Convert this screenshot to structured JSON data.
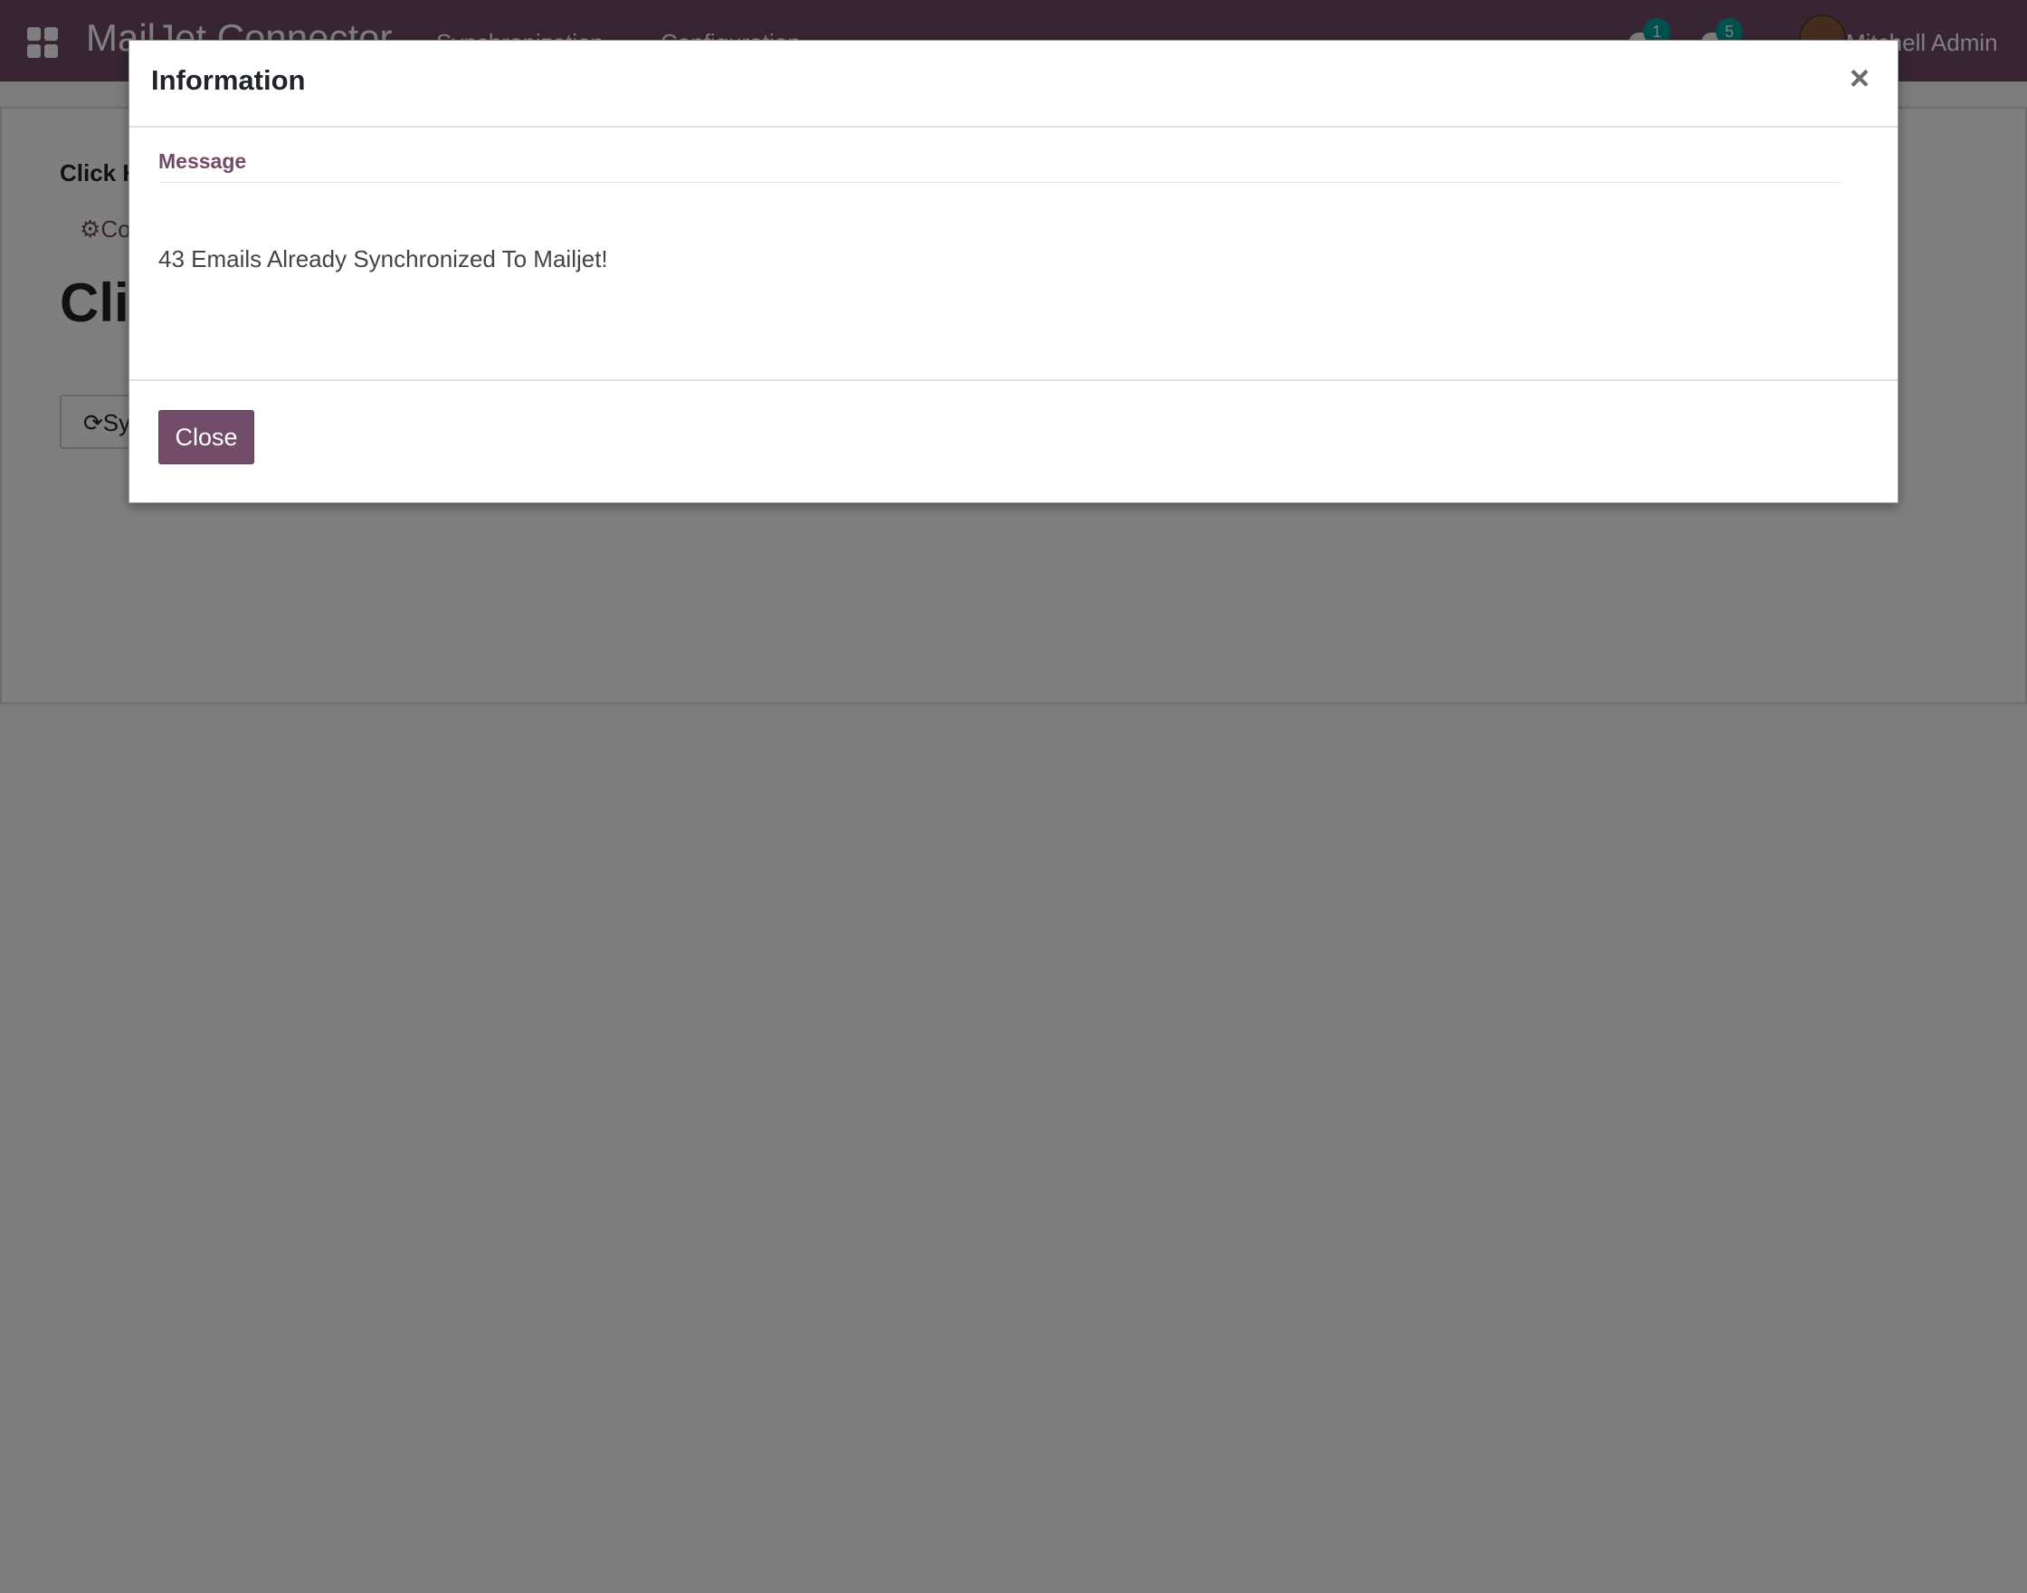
{
  "navbar": {
    "app_title": "MailJet Connector",
    "menus": [
      "Synchronization",
      "Configuration"
    ],
    "chat_count": "1",
    "activity_count": "5",
    "user_name": "Mitchell Admin",
    "brand_color": "#714b67"
  },
  "background_page": {
    "label": "Click H",
    "link": "Co",
    "title": "Cli",
    "button": "Sy"
  },
  "modal": {
    "title": "Information",
    "close_symbol": "×",
    "field_label": "Message",
    "field_value": "43 Emails Already Synchronized To Mailjet!",
    "close_button": "Close"
  },
  "icons": {
    "apps": "apps-grid-icon",
    "chat": "chat-icon",
    "activity": "clock-icon",
    "gears": "gears-icon",
    "sync": "refresh-icon"
  }
}
